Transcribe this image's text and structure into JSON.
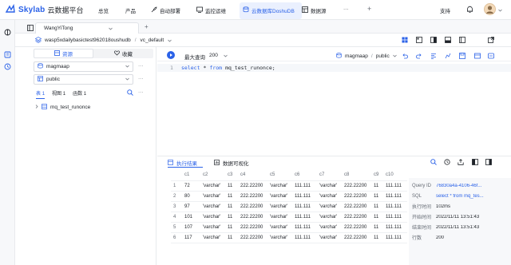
{
  "topnav": {
    "brand": "Skylab",
    "brand_sub": "云数据平台",
    "items": [
      "总览",
      "产品",
      "自动部署",
      "监控运维",
      "云数据库DoshuDB",
      "数据源"
    ],
    "more": "···",
    "add": "+",
    "support": "支持"
  },
  "tabbar": {
    "tab_label": "WangYiTong",
    "add": "+"
  },
  "crumb": {
    "instance": "wasp5xdailybasictest962018oushudb",
    "sep": "/",
    "schema": "vc_default"
  },
  "side": {
    "tab_resource": "资源",
    "tab_favorite": "收藏",
    "db_select": "magmaap",
    "schema_select": "public",
    "obj_tabs": [
      {
        "label": "表",
        "count": "1"
      },
      {
        "label": "视图",
        "count": "1"
      },
      {
        "label": "函数",
        "count": "1"
      }
    ],
    "tree_item": "mq_test_runonce",
    "more": "···"
  },
  "editor": {
    "run_label": "最大查询",
    "limit": "200",
    "context_db": "magmaap",
    "context_sep": "/",
    "context_schema": "public",
    "line_no": "1",
    "sql_kw1": "select",
    "sql_star": "*",
    "sql_kw2": "from",
    "sql_rest": "mq_test_runonce;"
  },
  "results": {
    "tab_result": "执行结果",
    "tab_viz": "数据可视化",
    "columns": [
      "",
      "c1",
      "c2",
      "c3",
      "c4",
      "c5",
      "c6",
      "c7",
      "c8",
      "c9",
      "c10"
    ],
    "rows": [
      [
        "1",
        "72",
        "'varchar'",
        "11",
        "222.22200",
        "'varchar'",
        "111.111",
        "'varchar'",
        "222.22200",
        "11",
        "111.111"
      ],
      [
        "2",
        "80",
        "'varchar'",
        "11",
        "222.22200",
        "'varchar'",
        "111.111",
        "'varchar'",
        "222.22200",
        "11",
        "111.111"
      ],
      [
        "3",
        "97",
        "'varchar'",
        "11",
        "222.22200",
        "'varchar'",
        "111.111",
        "'varchar'",
        "222.22200",
        "11",
        "111.111"
      ],
      [
        "4",
        "101",
        "'varchar'",
        "11",
        "222.22200",
        "'varchar'",
        "111.111",
        "'varchar'",
        "222.22200",
        "11",
        "111.111"
      ],
      [
        "5",
        "107",
        "'varchar'",
        "11",
        "222.22200",
        "'varchar'",
        "111.111",
        "'varchar'",
        "222.22200",
        "11",
        "111.111"
      ],
      [
        "6",
        "117",
        "'varchar'",
        "11",
        "222.22200",
        "'varchar'",
        "111.111",
        "'varchar'",
        "222.22200",
        "11",
        "111.111"
      ]
    ],
    "info": [
      {
        "k": "Query ID",
        "v": "76830a4a-4106-46f..."
      },
      {
        "k": "SQL",
        "v": "select * from mq_tes..."
      },
      {
        "k": "执行时间",
        "v": "102ms"
      },
      {
        "k": "开始时间",
        "v": "2022/11/11 13:51:43"
      },
      {
        "k": "结束时间",
        "v": "2022/11/11 13:51:43"
      },
      {
        "k": "行数",
        "v": "200"
      }
    ]
  },
  "colors": {
    "accent": "#2b62e8",
    "keyword": "#2b62e8",
    "border": "#e8eaed"
  }
}
